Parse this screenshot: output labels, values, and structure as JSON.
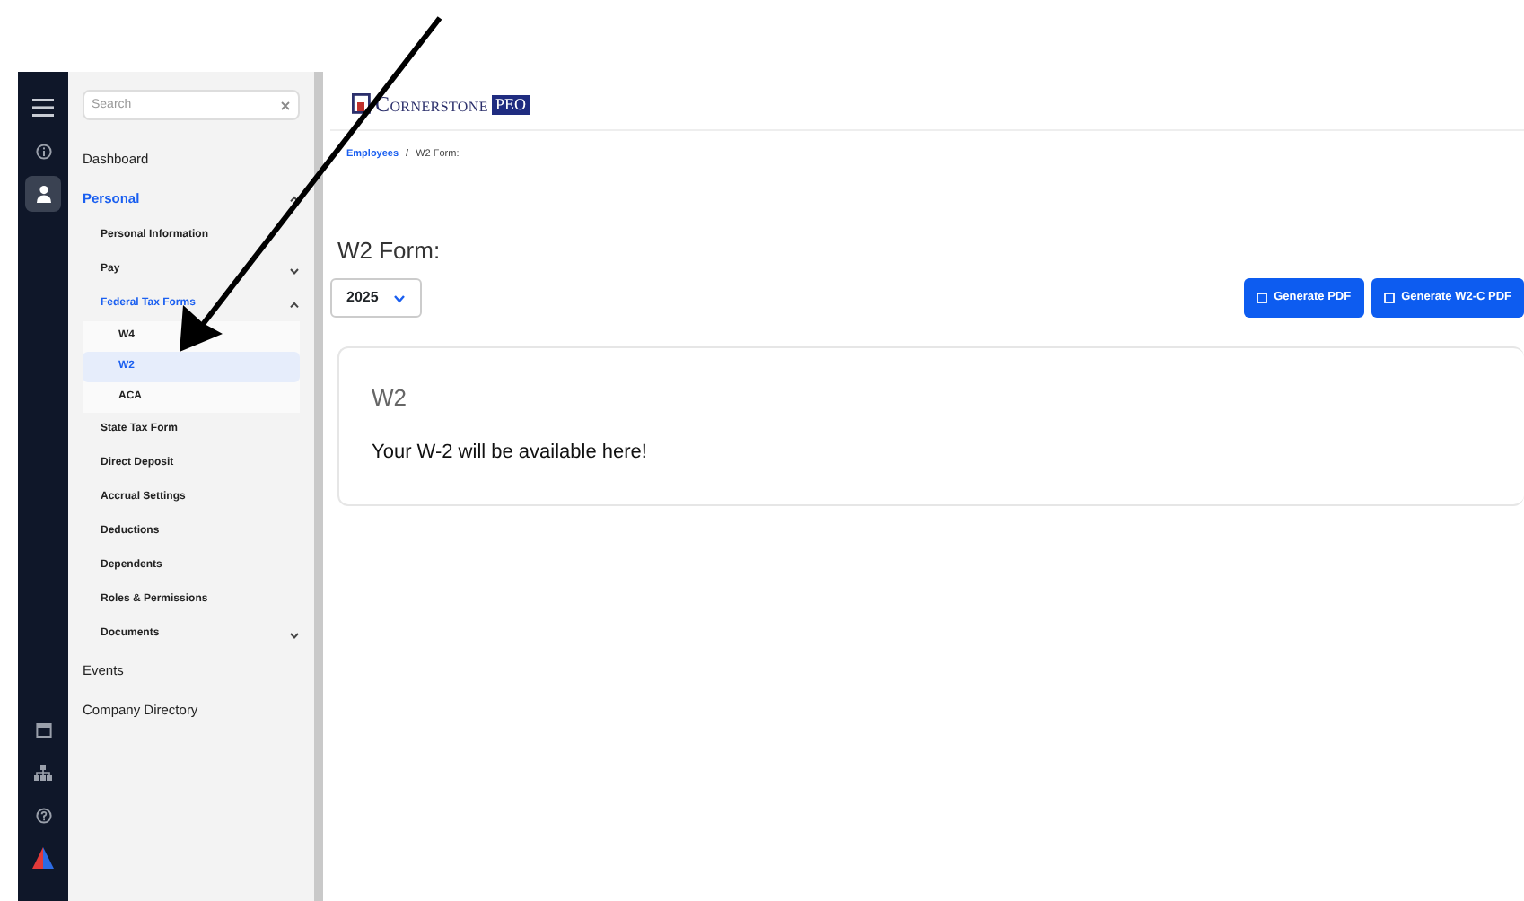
{
  "rail": [
    {
      "selected": false
    },
    {
      "selected": false
    },
    {
      "selected": true
    },
    {
      "selected": false
    },
    {
      "selected": false
    },
    {
      "selected": false
    },
    {
      "selected": false
    }
  ],
  "sidebar": {
    "search": {
      "placeholder": "Search"
    },
    "items": [
      {
        "label": "Dashboard",
        "selected": false
      },
      {
        "label": "Personal",
        "selected": true,
        "expanded": true,
        "children": [
          {
            "label": "Personal Information",
            "selected": false
          },
          {
            "label": "Pay",
            "selected": false,
            "expanded": false
          },
          {
            "label": "Federal Tax Forms",
            "selected": true,
            "expanded": true,
            "children": [
              {
                "label": "W4",
                "selected": false
              },
              {
                "label": "W2",
                "selected": true
              },
              {
                "label": "ACA",
                "selected": false
              }
            ]
          },
          {
            "label": "State Tax Form",
            "selected": false
          },
          {
            "label": "Direct Deposit",
            "selected": false
          },
          {
            "label": "Accrual Settings",
            "selected": false
          },
          {
            "label": "Deductions",
            "selected": false
          },
          {
            "label": "Dependents",
            "selected": false
          },
          {
            "label": "Roles & Permissions",
            "selected": false
          },
          {
            "label": "Documents",
            "selected": false,
            "expanded": false
          }
        ]
      },
      {
        "label": "Events",
        "selected": false
      },
      {
        "label": "Company Directory",
        "selected": false
      }
    ]
  },
  "logo": {
    "name": "Cornerstone",
    "tag": "PEO"
  },
  "breadcrumb": {
    "separator": "/",
    "items": [
      {
        "label": "Employees",
        "link": true
      },
      {
        "label": "W2 Form:",
        "link": false
      }
    ]
  },
  "page_title": "W2 Form:",
  "year_select": {
    "value": "2025"
  },
  "buttons": [
    {
      "label": "Generate PDF"
    },
    {
      "label": "Generate W2-C PDF"
    }
  ],
  "card": {
    "title": "W2",
    "text": "Your W-2 will be available here!"
  }
}
